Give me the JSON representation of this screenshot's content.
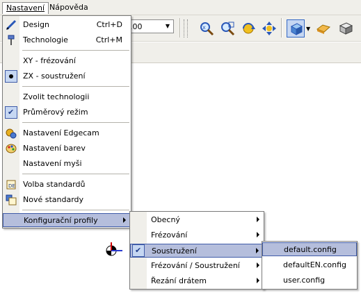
{
  "menubar": {
    "items": [
      {
        "label": "Nastavení"
      },
      {
        "label": "Nápověda"
      }
    ]
  },
  "toolbar": {
    "combo_value": ".00"
  },
  "main_menu": {
    "items": [
      {
        "label": "Design",
        "shortcut": "Ctrl+D"
      },
      {
        "label": "Technologie",
        "shortcut": "Ctrl+M"
      },
      {
        "label": "XY - frézování"
      },
      {
        "label": "ZX - soustružení"
      },
      {
        "label": "Zvolit technologii"
      },
      {
        "label": "Průměrový režim"
      },
      {
        "label": "Nastavení Edgecam"
      },
      {
        "label": "Nastavení barev"
      },
      {
        "label": "Nastavení myši"
      },
      {
        "label": "Volba standardů"
      },
      {
        "label": "Nové standardy"
      },
      {
        "label": "Konfigurační profily"
      }
    ]
  },
  "profiles_menu": {
    "items": [
      {
        "label": "Obecný"
      },
      {
        "label": "Frézování"
      },
      {
        "label": "Soustružení"
      },
      {
        "label": "Frézování / Soustružení"
      },
      {
        "label": "Řezání drátem"
      }
    ]
  },
  "config_menu": {
    "items": [
      {
        "label": "default.config"
      },
      {
        "label": "defaultEN.config"
      },
      {
        "label": "user.config"
      }
    ]
  },
  "colors": {
    "highlight": "#b5bedc",
    "highlight_border": "#3f5ba8",
    "menu_bg": "#ffffff",
    "bar_bg": "#f0efea"
  }
}
